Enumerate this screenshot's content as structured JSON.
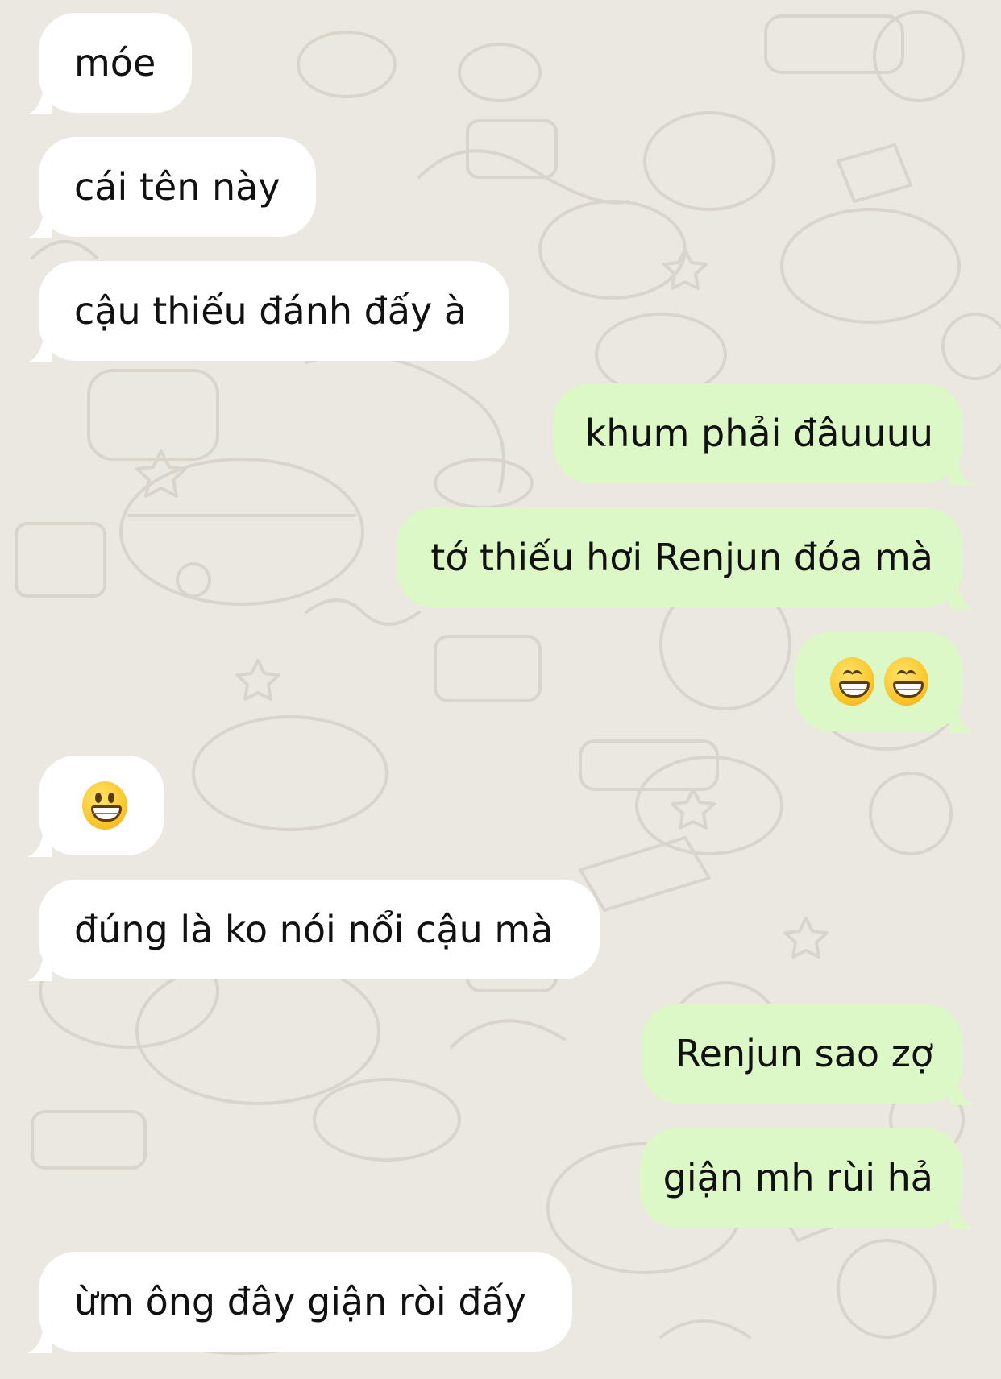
{
  "chat": {
    "messages": [
      {
        "side": "in",
        "text": "móe"
      },
      {
        "side": "in",
        "text": "cái tên này"
      },
      {
        "side": "in",
        "text": "cậu thiếu đánh đấy à"
      },
      {
        "side": "out",
        "text": "khum phải đâuuuu"
      },
      {
        "side": "out",
        "text": "tớ thiếu hơi Renjun đóa mà"
      },
      {
        "side": "out",
        "emoji": [
          "grinning-face-with-smiling-eyes",
          "grinning-face-with-smiling-eyes"
        ]
      },
      {
        "side": "in",
        "emoji": [
          "grinning-face"
        ]
      },
      {
        "side": "in",
        "text": "đúng là ko nói nổi cậu mà"
      },
      {
        "side": "out",
        "text": "Renjun sao zợ"
      },
      {
        "side": "out",
        "text": "giận mh rùi hả"
      },
      {
        "side": "in",
        "text": "ừm ông đây giận ròi đấy"
      }
    ]
  },
  "colors": {
    "background": "#ebe7e1",
    "incoming_bubble": "#ffffff",
    "outgoing_bubble": "#dcf8c6",
    "text": "#111111",
    "doodle": "#d9d4cc"
  }
}
